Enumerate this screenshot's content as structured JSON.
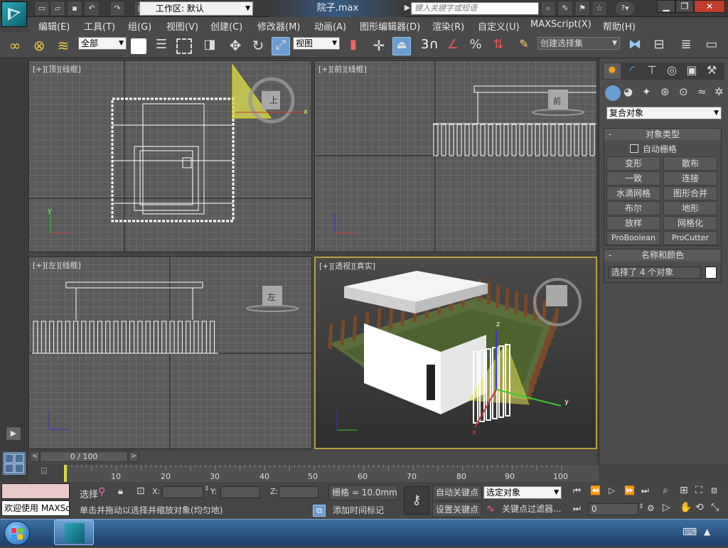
{
  "titlebar": {
    "workspace_label": "工作区: 默认",
    "file_title": "院子.max",
    "search_placeholder": "键入关键字或短语"
  },
  "menubar": {
    "items": [
      "编辑(E)",
      "工具(T)",
      "组(G)",
      "视图(V)",
      "创建(C)",
      "修改器(M)",
      "动画(A)",
      "图形编辑器(D)",
      "渲染(R)",
      "自定义(U)",
      "MAXScript(X)",
      "帮助(H)"
    ]
  },
  "toolbar": {
    "filter_select": "全部",
    "coord_select": "视图",
    "snap_label": "3",
    "selection_set": "创建选择集"
  },
  "viewports": {
    "top": "[+][顶][线框]",
    "front": "[+][前][线框]",
    "left": "[+][左][线框]",
    "persp": "[+][透视][真实]",
    "top_cube": "上",
    "front_cube": "前",
    "left_cube": "左",
    "axis_x": "x",
    "axis_y": "y",
    "axis_z": "z"
  },
  "command_panel": {
    "category_select": "复合对象",
    "rollout_object_type": "对象类型",
    "autogrid_label": "自动栅格",
    "buttons": [
      "变形",
      "散布",
      "一致",
      "连接",
      "水滴网格",
      "图形合并",
      "布尔",
      "地形",
      "放样",
      "网格化",
      "ProBoolean",
      "ProCutter"
    ],
    "rollout_name_color": "名称和颜色",
    "selection_name": "选择了 4 个对象",
    "object_color": "#ffffff"
  },
  "timeline": {
    "frame_display": "0 / 100",
    "ticks": [
      "10",
      "20",
      "30",
      "40",
      "50",
      "60",
      "70",
      "80",
      "90",
      "100"
    ]
  },
  "status": {
    "maxscript_label": "欢迎使用  MAXSc",
    "selection_label": "选择",
    "x_label": "X:",
    "y_label": "Y:",
    "z_label": "Z:",
    "grid_label": "栅格 = 10.0mm",
    "prompt": "单击并拖动以选择并缩放对象(均匀地)",
    "add_time_tag": "添加时间标记",
    "auto_key": "自动关键点",
    "key_mode_select": "选定对象",
    "set_key": "设置关键点",
    "key_filters": "关键点过滤器...",
    "frame_field": "0"
  }
}
